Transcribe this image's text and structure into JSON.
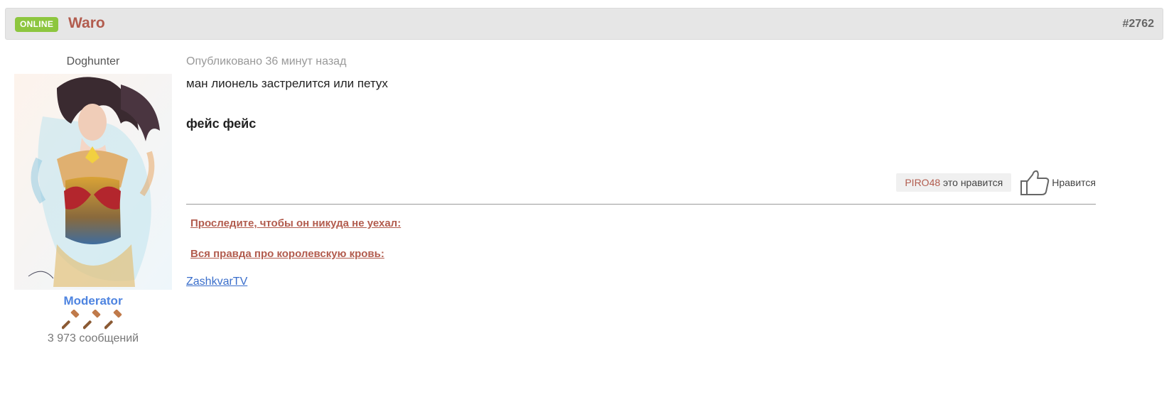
{
  "header": {
    "status_badge": "ONLINE",
    "author_name": "Waro",
    "post_number": "#2762"
  },
  "author": {
    "title": "Doghunter",
    "group": "Moderator",
    "rank_icons": [
      "gavel-icon",
      "gavel-icon",
      "gavel-icon"
    ],
    "post_count": "3 973 сообщений"
  },
  "post": {
    "date": "Опубликовано 36 минут назад",
    "line1": "ман лионель застрелится или петух",
    "line2": "фейс фейс"
  },
  "reactions": {
    "liker": "PIRO48",
    "liked_suffix": " это нравится",
    "like_label": "Нравится"
  },
  "signature": {
    "link1": "Проследите, чтобы он никуда не уехал:",
    "link2": "Вся правда про королевскую кровь:",
    "link3": "ZashkvarTV"
  },
  "colors": {
    "badge": "#8dc63f",
    "author_name": "#b25c4e",
    "group": "#4e84e0",
    "link": "#3a6ecb"
  }
}
